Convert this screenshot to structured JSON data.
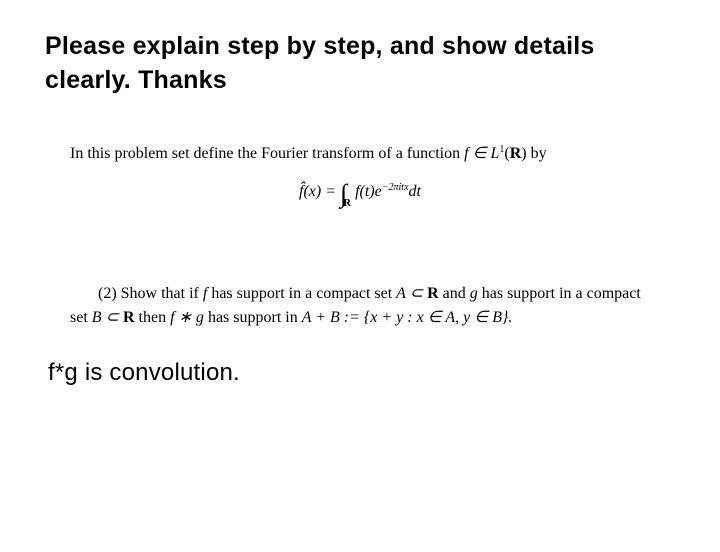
{
  "heading": "Please explain step by step, and show details clearly. Thanks",
  "intro_prefix": "In this problem set define the Fourier transform of a function ",
  "intro_math": "f ∈ L",
  "intro_sup": "1",
  "intro_math2": "(R)",
  "intro_suffix": " by",
  "formula": {
    "lhs": "f̂(x) = ",
    "int": "∫",
    "sub": "R",
    "integrand1": " f(t)e",
    "exp": "−2πitx",
    "integrand2": "dt"
  },
  "problem": {
    "label": "(2) Show that if ",
    "p1": "f",
    "p2": " has support in a compact set ",
    "p3": "A ⊂ ",
    "p3b": "R",
    "p4": " and ",
    "p5": "g",
    "p6": " has support in a compact set ",
    "p7": "B ⊂ ",
    "p7b": "R",
    "p8": " then ",
    "p9": "f ∗ g",
    "p10": " has support in ",
    "p11": "A + B := {x + y : x ∈ A, y ∈ B}.",
    "p11_pre": "A + B := {x + y : x ∈ ",
    "p11_mid": "A, y ∈ B}."
  },
  "footnote": "f*g is convolution."
}
